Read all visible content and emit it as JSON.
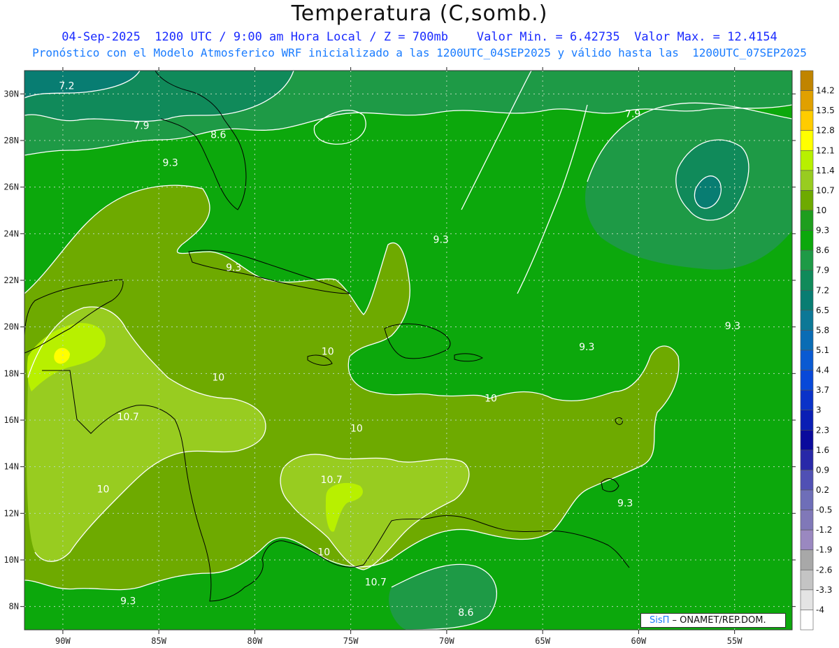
{
  "header": {
    "title": "Temperatura (C,somb.)",
    "date": "04-Sep-2025",
    "time": "1200 UTC / 9:00 am Hora Local / Z = 700mb",
    "min_label": "Valor Min. = 6.42735",
    "max_label": "Valor Max. = 12.4154",
    "forecast": "Pronóstico con el Modelo Atmosferico WRF inicializado a las 1200UTC_04SEP2025 y válido hasta las  1200UTC_07SEP2025"
  },
  "map": {
    "lon_range": [
      -92,
      -52
    ],
    "lat_range": [
      7,
      31
    ],
    "x_ticks": [
      {
        "lon": -90,
        "label": "90W"
      },
      {
        "lon": -85,
        "label": "85W"
      },
      {
        "lon": -80,
        "label": "80W"
      },
      {
        "lon": -75,
        "label": "75W"
      },
      {
        "lon": -70,
        "label": "70W"
      },
      {
        "lon": -65,
        "label": "65W"
      },
      {
        "lon": -60,
        "label": "60W"
      },
      {
        "lon": -55,
        "label": "55W"
      }
    ],
    "y_ticks": [
      {
        "lat": 30,
        "label": "30N"
      },
      {
        "lat": 28,
        "label": "28N"
      },
      {
        "lat": 26,
        "label": "26N"
      },
      {
        "lat": 24,
        "label": "24N"
      },
      {
        "lat": 22,
        "label": "22N"
      },
      {
        "lat": 20,
        "label": "20N"
      },
      {
        "lat": 18,
        "label": "18N"
      },
      {
        "lat": 16,
        "label": "16N"
      },
      {
        "lat": 14,
        "label": "14N"
      },
      {
        "lat": 12,
        "label": "12N"
      },
      {
        "lat": 10,
        "label": "10N"
      },
      {
        "lat": 8,
        "label": "8N"
      }
    ],
    "contour_labels": [
      {
        "text": "7.2",
        "lon": -89.8,
        "lat": 30.2
      },
      {
        "text": "7.9",
        "lon": -85.9,
        "lat": 28.5
      },
      {
        "text": "8.6",
        "lon": -81.9,
        "lat": 28.1
      },
      {
        "text": "9.3",
        "lon": -84.4,
        "lat": 26.9
      },
      {
        "text": "7.9",
        "lon": -60.3,
        "lat": 29.0
      },
      {
        "text": "9.3",
        "lon": -70.3,
        "lat": 23.6
      },
      {
        "text": "9.3",
        "lon": -81.1,
        "lat": 22.4
      },
      {
        "text": "9.3",
        "lon": -55.1,
        "lat": 19.9
      },
      {
        "text": "9.3",
        "lon": -62.7,
        "lat": 19.0
      },
      {
        "text": "10",
        "lon": -76.2,
        "lat": 18.8
      },
      {
        "text": "10",
        "lon": -81.9,
        "lat": 17.7
      },
      {
        "text": "10",
        "lon": -67.7,
        "lat": 16.8
      },
      {
        "text": "10.7",
        "lon": -86.6,
        "lat": 16.0
      },
      {
        "text": "10",
        "lon": -74.7,
        "lat": 15.5
      },
      {
        "text": "10.7",
        "lon": -76.0,
        "lat": 13.3
      },
      {
        "text": "10",
        "lon": -87.9,
        "lat": 12.9
      },
      {
        "text": "9.3",
        "lon": -60.7,
        "lat": 12.3
      },
      {
        "text": "10",
        "lon": -76.4,
        "lat": 10.2
      },
      {
        "text": "10.7",
        "lon": -73.7,
        "lat": 8.9
      },
      {
        "text": "9.3",
        "lon": -86.6,
        "lat": 8.1
      },
      {
        "text": "8.6",
        "lon": -69.0,
        "lat": 7.6
      }
    ]
  },
  "colorbar": {
    "levels": [
      {
        "label": "14.2",
        "color": "#c08400"
      },
      {
        "label": "13.5",
        "color": "#e0a000"
      },
      {
        "label": "12.8",
        "color": "#ffcc00"
      },
      {
        "label": "12.1",
        "color": "#ffff00"
      },
      {
        "label": "11.4",
        "color": "#b8f000"
      },
      {
        "label": "10.7",
        "color": "#98cc20"
      },
      {
        "label": "10",
        "color": "#6eaa00"
      },
      {
        "label": "9.3",
        "color": "#1e9e1e"
      },
      {
        "label": "8.6",
        "color": "#0ca80c"
      },
      {
        "label": "7.9",
        "color": "#1e9a46"
      },
      {
        "label": "7.2",
        "color": "#108a5a"
      },
      {
        "label": "6.5",
        "color": "#087d72"
      },
      {
        "label": "5.8",
        "color": "#0c7896"
      },
      {
        "label": "5.1",
        "color": "#0a6cb4"
      },
      {
        "label": "4.4",
        "color": "#0a5ad2"
      },
      {
        "label": "3.7",
        "color": "#0848d8"
      },
      {
        "label": "3",
        "color": "#0a32c8"
      },
      {
        "label": "2.3",
        "color": "#0a1eb4"
      },
      {
        "label": "1.6",
        "color": "#0a0a9c"
      },
      {
        "label": "0.9",
        "color": "#2828a8"
      },
      {
        "label": "0.2",
        "color": "#5050b4"
      },
      {
        "label": "-0.5",
        "color": "#6e6eb8"
      },
      {
        "label": "-1.2",
        "color": "#8078b8"
      },
      {
        "label": "-1.9",
        "color": "#9a88c0"
      },
      {
        "label": "-2.6",
        "color": "#a8a8a8"
      },
      {
        "label": "-3.3",
        "color": "#c4c4c4"
      },
      {
        "label": "-4",
        "color": "#e4e4e4"
      },
      {
        "label": "",
        "color": "#ffffff"
      }
    ]
  },
  "credit": {
    "brand": "SisΠ",
    "text": " – ONAMET/REP.DOM."
  }
}
